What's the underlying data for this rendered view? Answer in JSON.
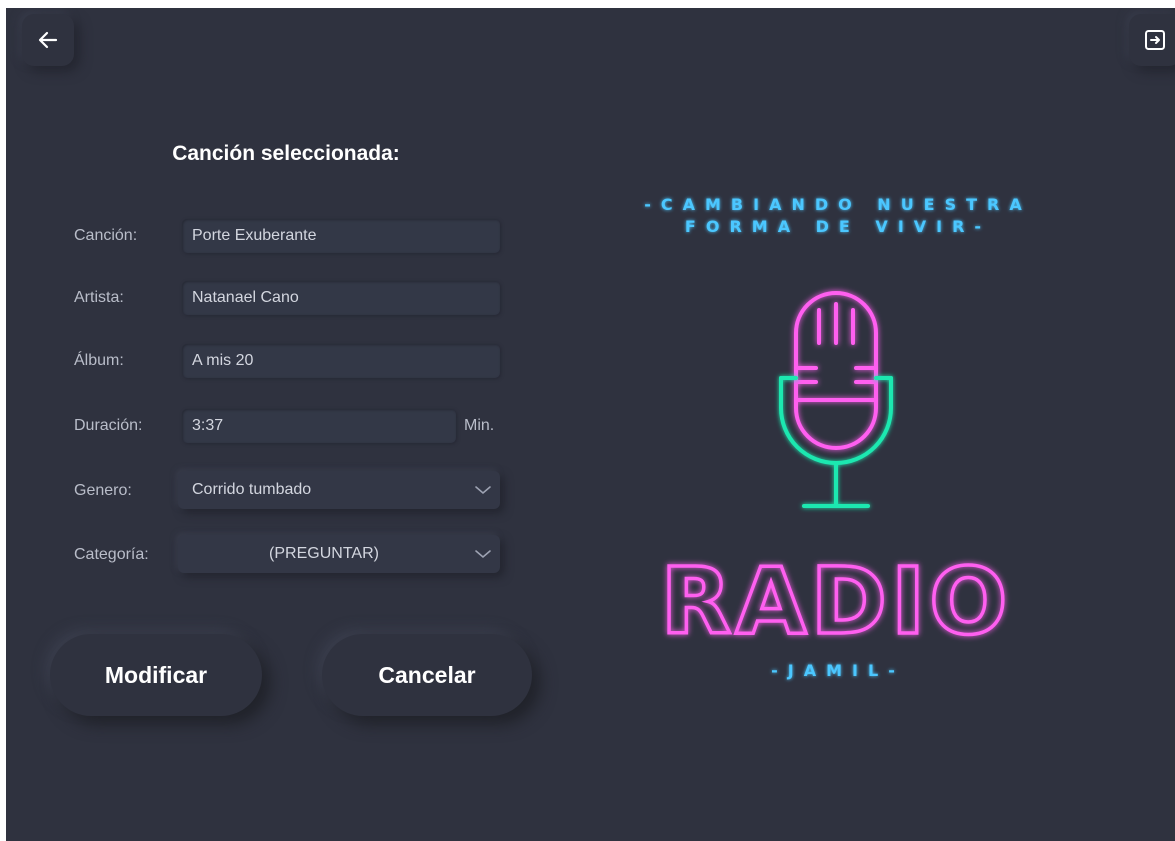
{
  "nav": {
    "back_icon": "arrow-left-icon",
    "exit_icon": "exit-icon"
  },
  "form": {
    "title": "Canción seleccionada:",
    "fields": [
      {
        "label": "Canción:",
        "value": "Porte Exuberante"
      },
      {
        "label": "Artista:",
        "value": "Natanael Cano"
      },
      {
        "label": "Álbum:",
        "value": "A mis 20"
      },
      {
        "label": "Duración:",
        "value": "3:37",
        "unit": "Min."
      }
    ],
    "genre": {
      "label": "Genero:",
      "value": "Corrido tumbado"
    },
    "category": {
      "label": "Categoría:",
      "value": "(PREGUNTAR)"
    }
  },
  "actions": {
    "modify_label": "Modificar",
    "cancel_label": "Cancelar"
  },
  "logo": {
    "tagline_line1": "-CAMBIANDO NUESTRA",
    "tagline_line2": "FORMA DE VIVIR-",
    "name": "RADIO",
    "subname": "-JAMIL-"
  },
  "colors": {
    "background": "#2f323f",
    "neon_pink": "#ff5ef0",
    "neon_green": "#1ee8b0",
    "neon_blue": "#4cc7ff"
  }
}
